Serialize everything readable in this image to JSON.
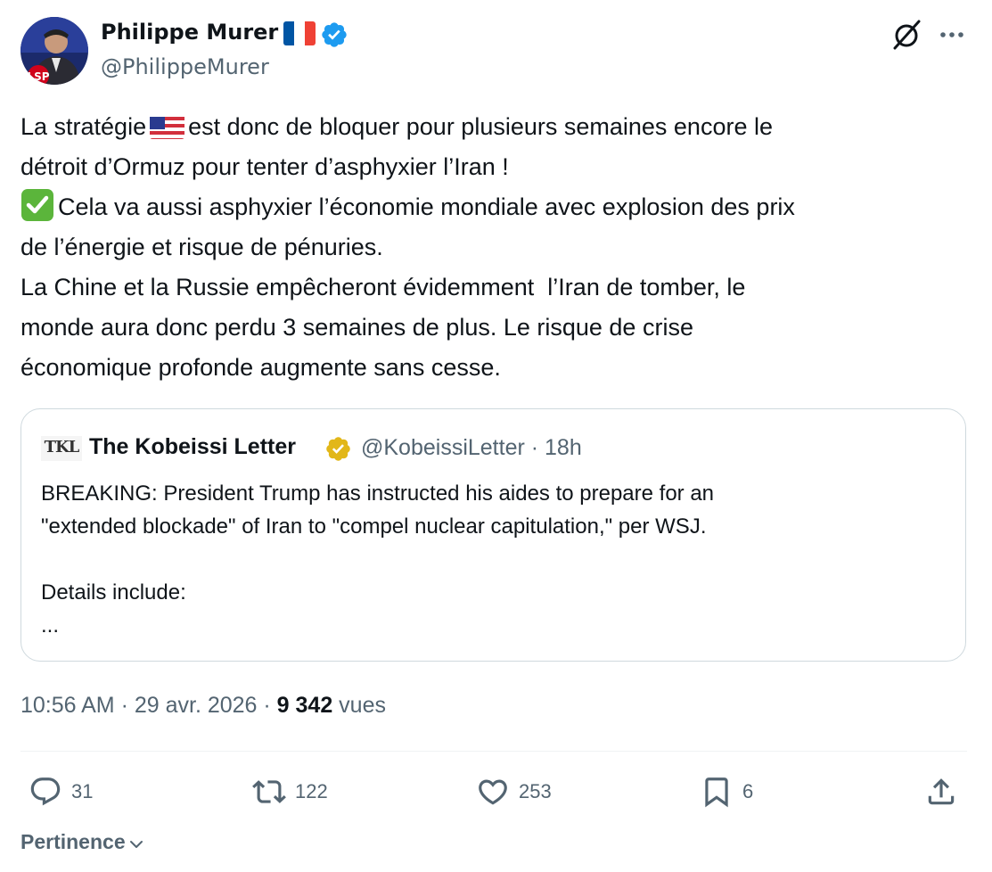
{
  "author": {
    "name": "Philippe Murer",
    "handle": "@PhilippeMurer",
    "avatar_badge": "LSP"
  },
  "tweet": {
    "lines": [
      {
        "before_flag": "La stratégie",
        "after_flag": "est donc de bloquer pour plusieurs semaines encore le"
      },
      {
        "text": "détroit d’Ormuz pour tenter d’asphyxier l’Iran !"
      },
      {
        "after_check": "Cela va aussi asphyxier l’économie mondiale avec explosion des prix"
      },
      {
        "text": "de l’énergie et risque de pénuries."
      },
      {
        "text": "La Chine et la Russie empêcheront évidemment  l’Iran de tomber, le"
      },
      {
        "text": "monde aura donc perdu 3 semaines de plus. Le risque de crise"
      },
      {
        "text": "économique profonde augmente sans cesse."
      }
    ]
  },
  "quote": {
    "avatar_text": "TKL",
    "name": "The Kobeissi Letter",
    "handle_time": "@KobeissiLetter · 18h",
    "lines": [
      "BREAKING: President Trump has instructed his aides to prepare for an",
      "\"extended blockade\" of Iran to \"compel nuclear capitulation,\" per WSJ.",
      "",
      "Details include:",
      "..."
    ]
  },
  "meta": {
    "time_date": "10:56 AM · 29 avr. 2026 · ",
    "views_count": "9 342",
    "views_label": " vues"
  },
  "actions": {
    "reply_count": "31",
    "retweet_count": "122",
    "like_count": "253",
    "bookmark_count": "6"
  },
  "sort_label": "Pertinence",
  "colors": {
    "verified_blue": "#1d9bf0",
    "verified_gold": "#e2b719",
    "muted": "#536471",
    "text": "#0f1419"
  }
}
